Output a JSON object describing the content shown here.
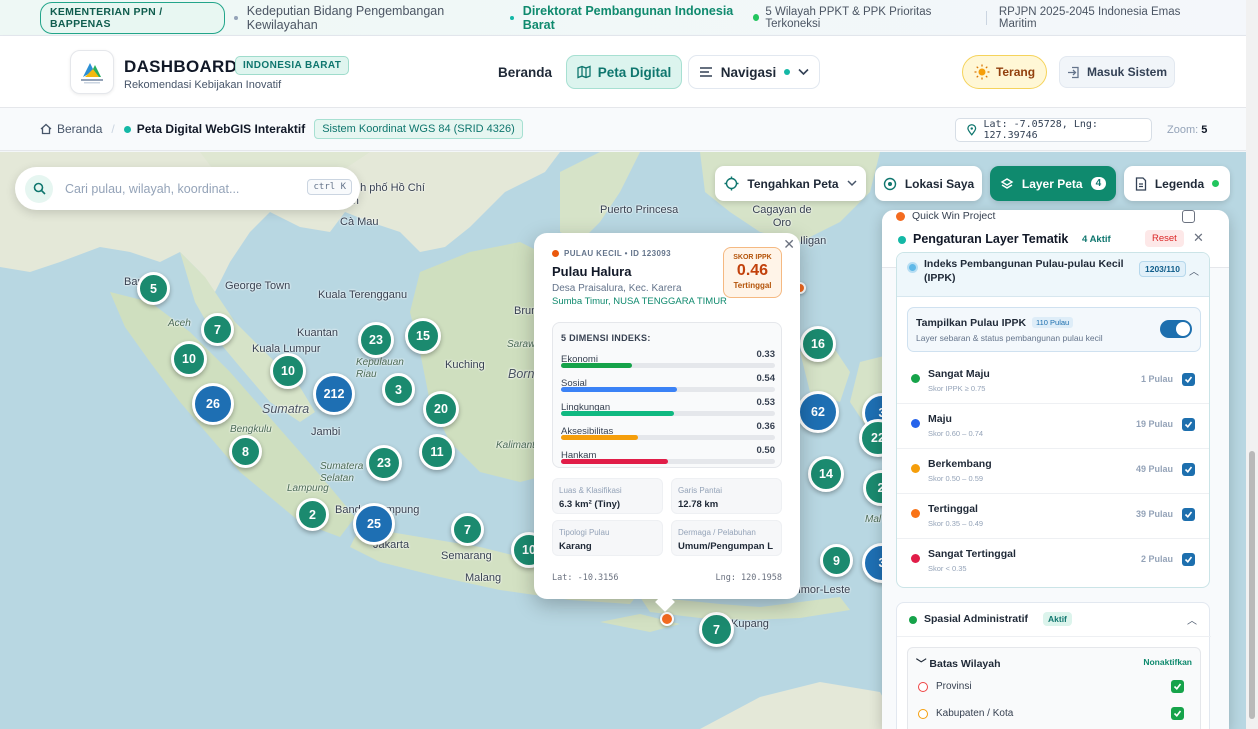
{
  "topbar": {
    "ministry": "KEMENTERIAN PPN / BAPPENAS",
    "deputy": "Kedeputian Bidang Pengembangan Kewilayahan",
    "directorate": "Direktorat Pembangunan Indonesia Barat",
    "status": "5 Wilayah PPKT & PPK Prioritas Terkoneksi",
    "vision": "RPJPN 2025-2045 Indonesia Emas Maritim"
  },
  "header": {
    "title": "DASHBOARD",
    "badge": "INDONESIA BARAT",
    "subtitle": "Rekomendasi Kebijakan Inovatif",
    "nav": {
      "home": "Beranda",
      "map": "Peta Digital",
      "navigation": "Navigasi"
    },
    "theme": "Terang",
    "login": "Masuk Sistem"
  },
  "breadcrumb": {
    "home": "Beranda",
    "current": "Peta Digital WebGIS Interaktif",
    "crs": "Sistem Koordinat WGS 84 (SRID 4326)",
    "coords": "Lat: -7.05728, Lng: 127.39746",
    "zoom_label": "Zoom:",
    "zoom_value": "5"
  },
  "map": {
    "search": {
      "placeholder": "Cari pulau, wilayah, koordinat...",
      "shortcut": "ctrl K"
    },
    "controls": {
      "center": "Tengahkan Peta",
      "locate": "Lokasi Saya",
      "layers": "Layer Peta",
      "layers_count": "4",
      "legend": "Legenda"
    },
    "places": [
      "Bangkok",
      "Thành phố Hồ Chí Minh",
      "Cà Mau",
      "George Town",
      "Kuala Terengganu",
      "Kuantan",
      "Kuala Lumpur",
      "Aceh",
      "Sumatra",
      "Jambi",
      "Bengkulu",
      "Sumatera Selatan",
      "Lampung",
      "Bandar Lampung",
      "Jakarta",
      "Semarang",
      "Malang",
      "Kuching",
      "Kepulauan Riau",
      "Borneo",
      "Kalimantan",
      "Sarawak",
      "Puerto Princesa",
      "Cagayan de Oro",
      "Iligan",
      "Brunei",
      "Timor-Leste",
      "Kupang",
      "Mal"
    ],
    "clusters": [
      "5",
      "7",
      "10",
      "26",
      "10",
      "212",
      "23",
      "15",
      "3",
      "20",
      "8",
      "11",
      "23",
      "2",
      "25",
      "7",
      "10",
      "16",
      "62",
      "3",
      "22",
      "14",
      "2",
      "9",
      "3",
      "7"
    ]
  },
  "popup": {
    "kicker": "PULAU KECIL • ID 123093",
    "name": "Pulau Halura",
    "village": "Desa Praisalura, Kec. Karera",
    "region": "Sumba Timur, NUSA TENGGARA TIMUR",
    "score_label": "SKOR IPPK",
    "score_value": "0.46",
    "score_status": "Tertinggal",
    "dim_title": "5 DIMENSI INDEKS:",
    "dimensions": [
      {
        "name": "Ekonomi",
        "label": "0.33",
        "value": 0.33,
        "color": "#16a34a"
      },
      {
        "name": "Sosial",
        "label": "0.54",
        "value": 0.54,
        "color": "#3b82f6"
      },
      {
        "name": "Lingkungan",
        "label": "0.53",
        "value": 0.53,
        "color": "#10b981"
      },
      {
        "name": "Aksesibilitas",
        "label": "0.36",
        "value": 0.36,
        "color": "#f59e0b"
      },
      {
        "name": "Hankam",
        "label": "0.50",
        "value": 0.5,
        "color": "#e11d48"
      }
    ],
    "info": [
      {
        "key": "Luas & Klasifikasi",
        "value": "6.3 km² (Tiny)"
      },
      {
        "key": "Garis Pantai",
        "value": "12.78 km"
      },
      {
        "key": "Tipologi Pulau",
        "value": "Karang"
      },
      {
        "key": "Dermaga / Pelabuhan",
        "value": "Umum/Pengumpan L"
      }
    ],
    "lat": "Lat: -10.3156",
    "lng": "Lng: 120.1958"
  },
  "panel": {
    "quickwin": "Quick Win Project",
    "title": "Pengaturan Layer Tematik",
    "active": "4 Aktif",
    "reset": "Reset",
    "ippk": {
      "title": "Indeks Pembangunan Pulau-pulau Kecil (IPPK)",
      "count": "1203/110",
      "show_title": "Tampilkan Pulau IPPK",
      "show_badge": "110 Pulau",
      "show_sub": "Layer sebaran & status pembangunan pulau kecil"
    },
    "categories": [
      {
        "name": "Sangat Maju",
        "range": "Skor IPPK ≥ 0.75",
        "count": "1 Pulau",
        "color": "#16a34a"
      },
      {
        "name": "Maju",
        "range": "Skor 0.60 – 0.74",
        "count": "19 Pulau",
        "color": "#2563eb"
      },
      {
        "name": "Berkembang",
        "range": "Skor 0.50 – 0.59",
        "count": "49 Pulau",
        "color": "#f59e0b"
      },
      {
        "name": "Tertinggal",
        "range": "Skor 0.35 – 0.49",
        "count": "39 Pulau",
        "color": "#f97316"
      },
      {
        "name": "Sangat Tertinggal",
        "range": "Skor < 0.35",
        "count": "2 Pulau",
        "color": "#e11d48"
      }
    ],
    "spatial": {
      "title": "Spasial Administratif",
      "badge": "Aktif",
      "sub_title": "Batas Wilayah",
      "sub_action": "Nonaktifkan",
      "items": [
        {
          "name": "Provinsi",
          "color": "#ef4444"
        },
        {
          "name": "Kabupaten / Kota",
          "color": "#f59e0b"
        }
      ]
    }
  }
}
